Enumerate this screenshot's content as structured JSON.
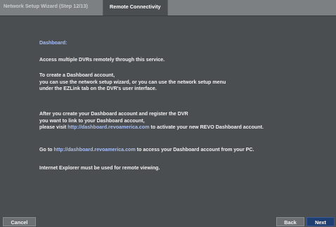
{
  "header": {
    "step_tab": "Network Setup Wizard (Step 12/13)",
    "active_tab": "Remote Connectivity"
  },
  "content": {
    "heading": "Dashboard:",
    "line1": "Access multiple DVRs remotely through this service.",
    "para2_line1": "To create a Dashboard account,",
    "para2_line2": "you can use the network setup wizard, or you can use the network setup menu",
    "para2_line3": "under the EZLink tab on the DVR's user interface.",
    "para3_line1": "After you create your Dashboard account and register the DVR",
    "para3_line2": " you want to link to your Dashboard account,",
    "para3_line3_prefix": "please visit ",
    "para3_line3_link": "http://dashboard.revoamerica.com",
    "para3_line3_suffix": " to activate your new REVO Dashboard account.",
    "para4_prefix": "Go to ",
    "para4_link": "http://dashboard.revoamerica.com",
    "para4_suffix": " to access your Dashboard account from your PC.",
    "para5": "Internet Explorer must be used for remote viewing."
  },
  "footer": {
    "cancel_label": "Cancel",
    "back_label": "Back",
    "next_label": "Next"
  },
  "colors": {
    "background": "#4b4e51",
    "titlebar": "#7d8083",
    "accent_link": "#a9bff5",
    "next_button": "#1f3e72"
  }
}
